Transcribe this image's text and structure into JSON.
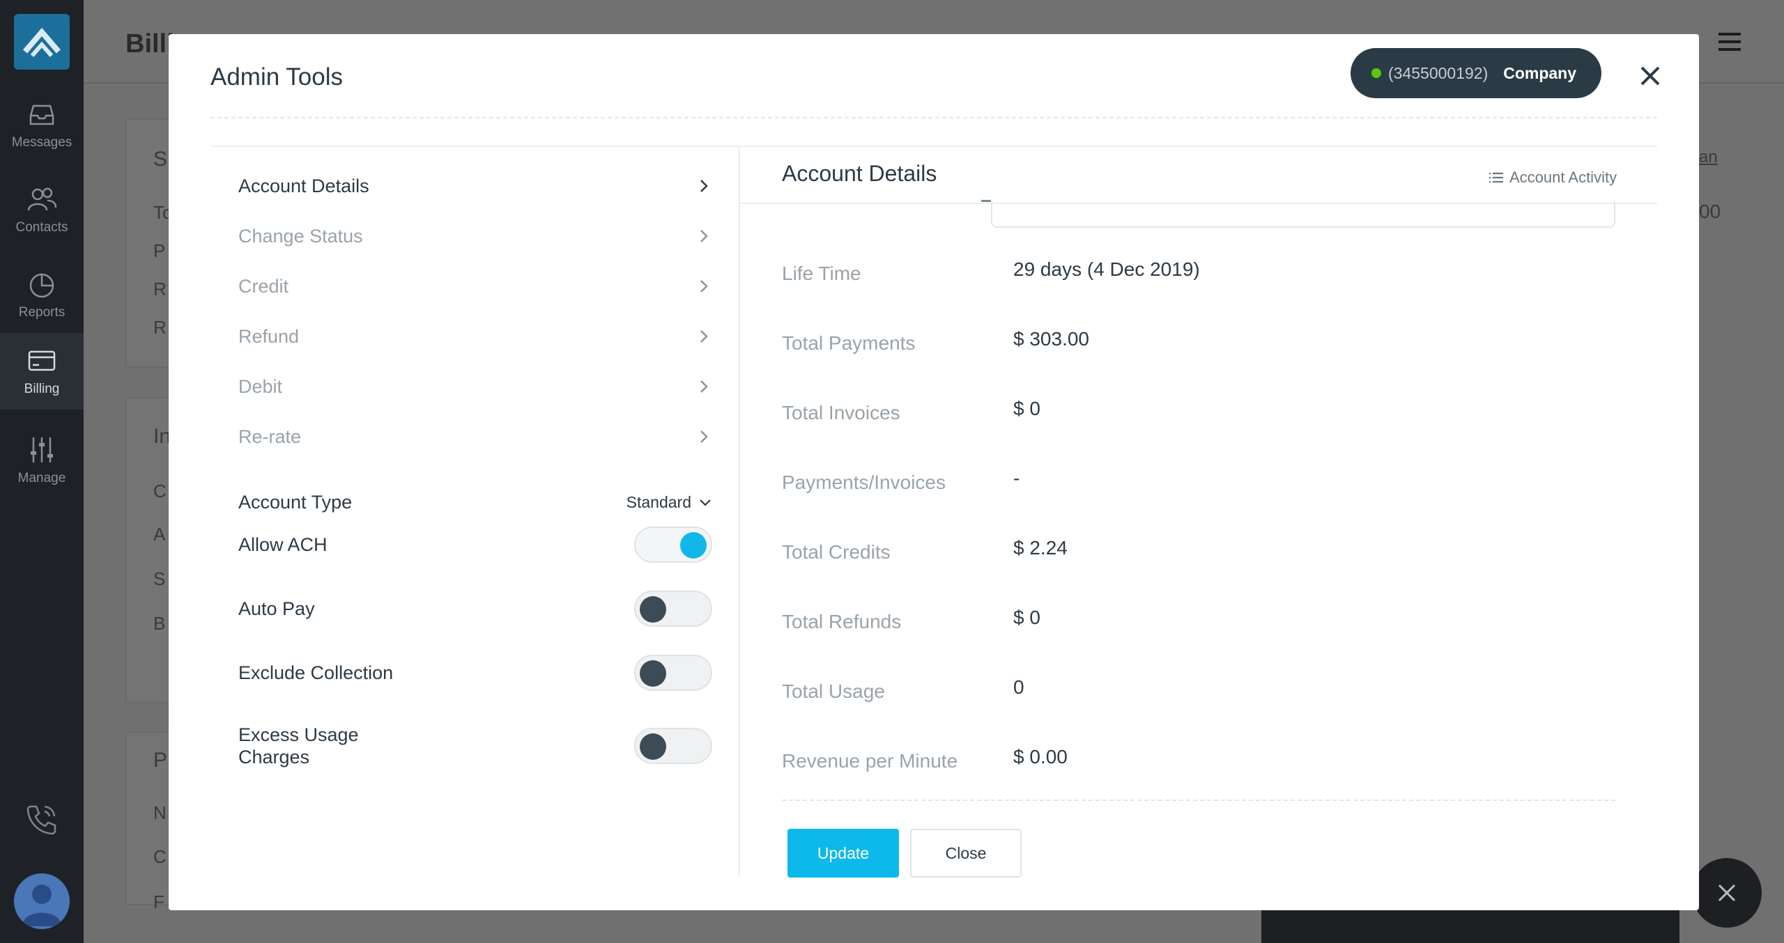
{
  "app": {
    "page_title": "Billi",
    "nav": [
      {
        "label": "Messages",
        "icon": "inbox-icon"
      },
      {
        "label": "Contacts",
        "icon": "contacts-icon"
      },
      {
        "label": "Reports",
        "icon": "pie-chart-icon"
      },
      {
        "label": "Billing",
        "icon": "credit-card-icon"
      },
      {
        "label": "Manage",
        "icon": "sliders-icon"
      }
    ],
    "bg_letters": {
      "card1": [
        "S",
        "To",
        "P",
        "R",
        "R"
      ],
      "card2": [
        "In",
        "C",
        "A",
        "S",
        "B"
      ],
      "card3": [
        "P",
        "N",
        "C",
        "F"
      ],
      "right_fragments": [
        "an",
        "00"
      ]
    }
  },
  "modal": {
    "title": "Admin Tools",
    "company": {
      "number": "(3455000192)",
      "name": "Company",
      "status_color": "#5ac80a"
    },
    "menu": [
      {
        "label": "Account Details",
        "active": true
      },
      {
        "label": "Change Status",
        "active": false
      },
      {
        "label": "Credit",
        "active": false
      },
      {
        "label": "Refund",
        "active": false
      },
      {
        "label": "Debit",
        "active": false
      },
      {
        "label": "Re-rate",
        "active": false
      }
    ],
    "account_type": {
      "label": "Account Type",
      "value": "Standard"
    },
    "toggles": [
      {
        "label": "Allow ACH",
        "on": true
      },
      {
        "label": "Auto Pay",
        "on": false
      },
      {
        "label": "Exclude Collection",
        "on": false
      },
      {
        "label": "Excess Usage Charges",
        "on": false
      }
    ],
    "panel": {
      "title": "Account Details",
      "activity_link": "Account Activity",
      "details": [
        {
          "label": "Life Time",
          "value": "29 days (4 Dec 2019)"
        },
        {
          "label": "Total Payments",
          "value": "$ 303.00"
        },
        {
          "label": "Total Invoices",
          "value": "$ 0"
        },
        {
          "label": "Payments/Invoices",
          "value": "-"
        },
        {
          "label": "Total Credits",
          "value": "$ 2.24"
        },
        {
          "label": "Total Refunds",
          "value": "$ 0"
        },
        {
          "label": "Total Usage",
          "value": "0"
        },
        {
          "label": "Revenue per Minute",
          "value": "$ 0.00"
        }
      ]
    },
    "buttons": {
      "update": "Update",
      "close": "Close"
    }
  },
  "colors": {
    "accent": "#0db9ea",
    "dark": "#2b3b45",
    "status_online": "#5ac80a"
  }
}
